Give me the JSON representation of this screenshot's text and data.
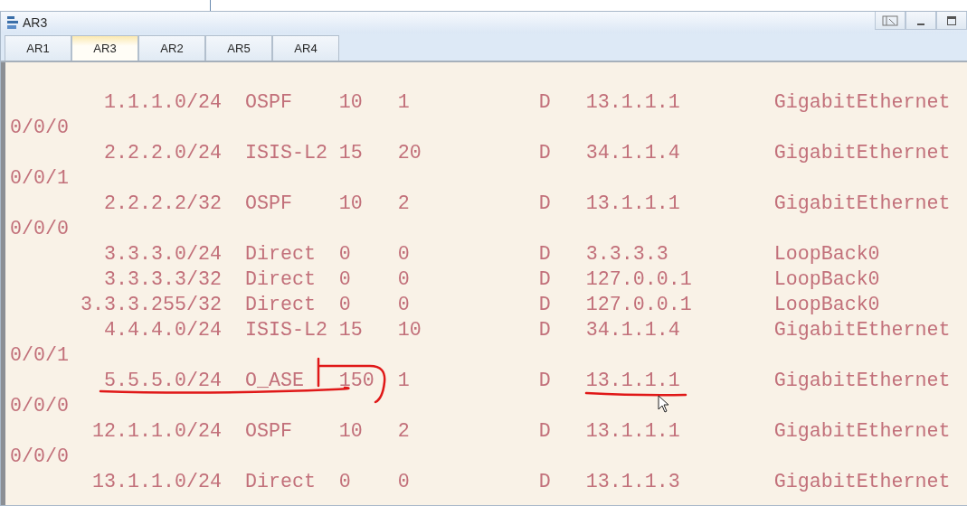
{
  "window": {
    "title": "AR3"
  },
  "tabs": [
    {
      "label": "AR1",
      "selected": false
    },
    {
      "label": "AR3",
      "selected": true
    },
    {
      "label": "AR2",
      "selected": false
    },
    {
      "label": "AR5",
      "selected": false
    },
    {
      "label": "AR4",
      "selected": false
    }
  ],
  "routes": [
    {
      "destination": "1.1.1.0/24",
      "proto": "OSPF",
      "pre": "10",
      "cost": "1",
      "flags": "D",
      "nexthop": "13.1.1.1",
      "interface": "GigabitEthernet",
      "interface_wrap": "0/0/0"
    },
    {
      "destination": "2.2.2.0/24",
      "proto": "ISIS-L2",
      "pre": "15",
      "cost": "20",
      "flags": "D",
      "nexthop": "34.1.1.4",
      "interface": "GigabitEthernet",
      "interface_wrap": "0/0/1"
    },
    {
      "destination": "2.2.2.2/32",
      "proto": "OSPF",
      "pre": "10",
      "cost": "2",
      "flags": "D",
      "nexthop": "13.1.1.1",
      "interface": "GigabitEthernet",
      "interface_wrap": "0/0/0"
    },
    {
      "destination": "3.3.3.0/24",
      "proto": "Direct",
      "pre": "0",
      "cost": "0",
      "flags": "D",
      "nexthop": "3.3.3.3",
      "interface": "LoopBack0"
    },
    {
      "destination": "3.3.3.3/32",
      "proto": "Direct",
      "pre": "0",
      "cost": "0",
      "flags": "D",
      "nexthop": "127.0.0.1",
      "interface": "LoopBack0"
    },
    {
      "destination": "3.3.3.255/32",
      "proto": "Direct",
      "pre": "0",
      "cost": "0",
      "flags": "D",
      "nexthop": "127.0.0.1",
      "interface": "LoopBack0"
    },
    {
      "destination": "4.4.4.0/24",
      "proto": "ISIS-L2",
      "pre": "15",
      "cost": "10",
      "flags": "D",
      "nexthop": "34.1.1.4",
      "interface": "GigabitEthernet",
      "interface_wrap": "0/0/1"
    },
    {
      "destination": "5.5.5.0/24",
      "proto": "O_ASE",
      "pre": "150",
      "cost": "1",
      "flags": "D",
      "nexthop": "13.1.1.1",
      "interface": "GigabitEthernet",
      "interface_wrap": "0/0/0"
    },
    {
      "destination": "12.1.1.0/24",
      "proto": "OSPF",
      "pre": "10",
      "cost": "2",
      "flags": "D",
      "nexthop": "13.1.1.1",
      "interface": "GigabitEthernet",
      "interface_wrap": "0/0/0"
    },
    {
      "destination": "13.1.1.0/24",
      "proto": "Direct",
      "pre": "0",
      "cost": "0",
      "flags": "D",
      "nexthop": "13.1.1.3",
      "interface": "GigabitEthernet"
    }
  ]
}
